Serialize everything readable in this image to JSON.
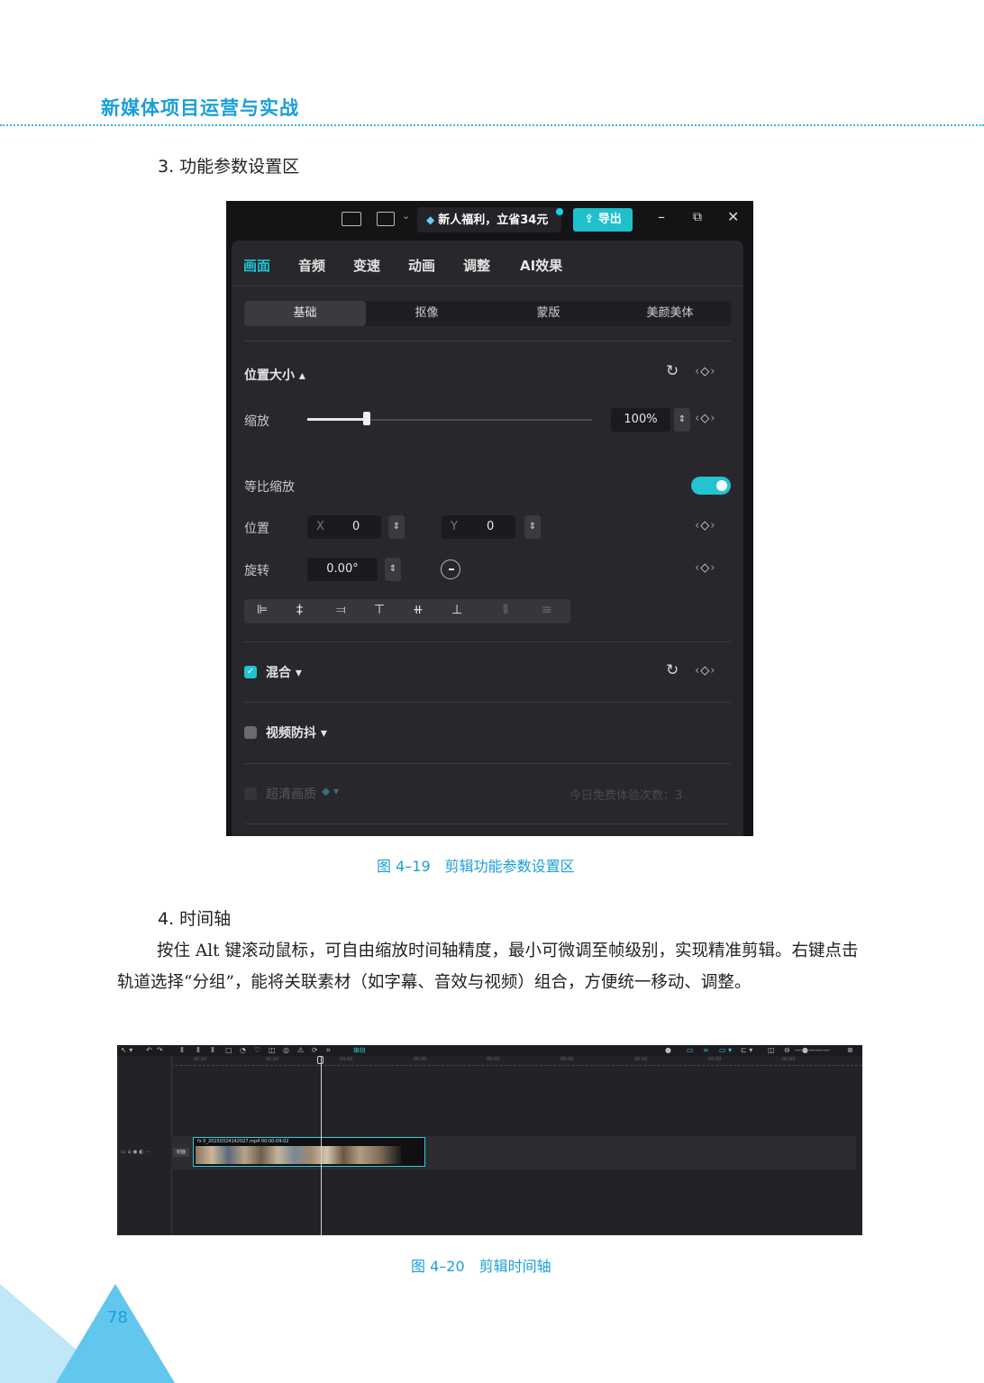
{
  "header": {
    "book_title": "新媒体项目运营与实战"
  },
  "section3": {
    "heading": "3. 功能参数设置区"
  },
  "figure_4_19": {
    "caption": "图 4–19　剪辑功能参数设置区",
    "topbar": {
      "promo_text": "新人福利，立省34元",
      "export_label": "导出",
      "minimize": "–",
      "restore": "⧉",
      "close": "✕"
    },
    "tabs": [
      "画面",
      "音频",
      "变速",
      "动画",
      "调整",
      "AI效果"
    ],
    "subtabs": [
      "基础",
      "抠像",
      "蒙版",
      "美颜美体"
    ],
    "position_size": {
      "title": "位置大小 ▴"
    },
    "scale": {
      "label": "缩放",
      "value": "100%",
      "level_fraction": 0.21
    },
    "uniform_scale": {
      "label": "等比缩放",
      "on": true
    },
    "position": {
      "label": "位置",
      "x_label": "X",
      "x_value": "0",
      "y_label": "Y",
      "y_value": "0"
    },
    "rotation": {
      "label": "旋转",
      "value": "0.00°"
    },
    "blend": {
      "label": "混合 ▾"
    },
    "stabilize": {
      "label": "视频防抖 ▾"
    },
    "hd": {
      "label": "超清画质",
      "free_trials": "今日免费体验次数：3"
    },
    "icons": [
      "reset-icon",
      "keyframe-diamond-icon",
      "stepper-icon",
      "rotation-dial-icon",
      "align-icon",
      "diamond-vip-icon"
    ],
    "accent_color": "#22c3d2"
  },
  "section4": {
    "heading": "4. 时间轴",
    "paragraph": [
      "按住 Alt 键滚动鼠标，可自由缩放时间轴精度，最小可微调至帧级别，实现精准剪辑。右键点击轨道选择“分组”，能将关联素材（如字幕、音效与视频）组合，方便统一移动、调整。"
    ]
  },
  "figure_4_20": {
    "caption": "图 4–20　剪辑时间轴",
    "clip_name": "fx 0_20250324142027.mp4  00:00:09:02",
    "cover_label": "封面",
    "ruler_ticks": [
      "00:00",
      "00:00",
      "00:00",
      "00:00",
      "00:00",
      "00:00",
      "00:00",
      "00:00",
      "00:00"
    ]
  },
  "footer": {
    "page_number": "78"
  }
}
